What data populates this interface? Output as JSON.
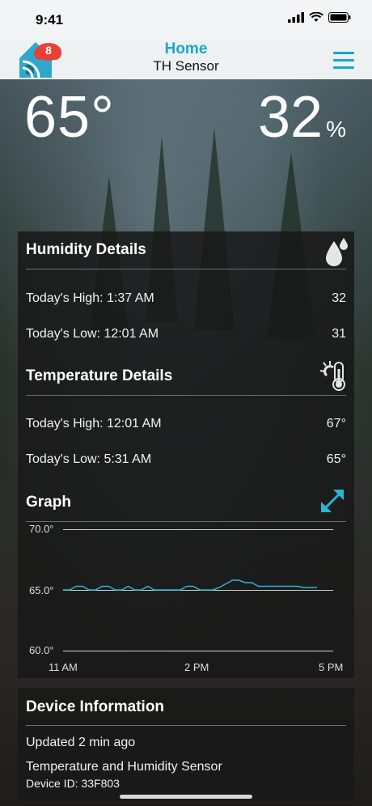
{
  "status_bar": {
    "time": "9:41"
  },
  "header": {
    "title": "Home",
    "subtitle": "TH Sensor",
    "badge_count": "8"
  },
  "reading": {
    "temperature": "65°",
    "humidity": "32",
    "humidity_unit": "%"
  },
  "humidity": {
    "title": "Humidity Details",
    "high_label": "Today's High: 1:37 AM",
    "high_value": "32",
    "low_label": "Today's Low: 12:01 AM",
    "low_value": "31"
  },
  "temperature": {
    "title": "Temperature Details",
    "high_label": "Today's High: 12:01 AM",
    "high_value": "67°",
    "low_label": "Today's Low: 5:31 AM",
    "low_value": "65°"
  },
  "graph": {
    "title": "Graph",
    "y_labels": [
      "70.0°",
      "65.0°",
      "60.0°"
    ],
    "x_labels": [
      "11 AM",
      "2 PM",
      "5 PM"
    ],
    "line_color": "#29b6d6"
  },
  "chart_data": {
    "type": "line",
    "ylim": [
      60,
      70
    ],
    "yticks": [
      60,
      65,
      70
    ],
    "xticks": [
      "11 AM",
      "2 PM",
      "5 PM"
    ],
    "series": [
      {
        "values": [
          65.0,
          65.0,
          65.3,
          65.3,
          65.0,
          65.0,
          65.3,
          65.3,
          65.0,
          65.0,
          65.3,
          65.0,
          65.0,
          65.3,
          65.0,
          65.0,
          65.0,
          65.0,
          65.0,
          65.3,
          65.3,
          65.0,
          65.0,
          65.0,
          65.2,
          65.5,
          65.8,
          65.8,
          65.6,
          65.6,
          65.3,
          65.3,
          65.3,
          65.3,
          65.3,
          65.3,
          65.3,
          65.2,
          65.2,
          65.2
        ]
      }
    ]
  },
  "device": {
    "title": "Device Information",
    "updated": "Updated 2 min ago",
    "type": "Temperature and Humidity Sensor",
    "device_id": "Device ID: 33F803"
  }
}
